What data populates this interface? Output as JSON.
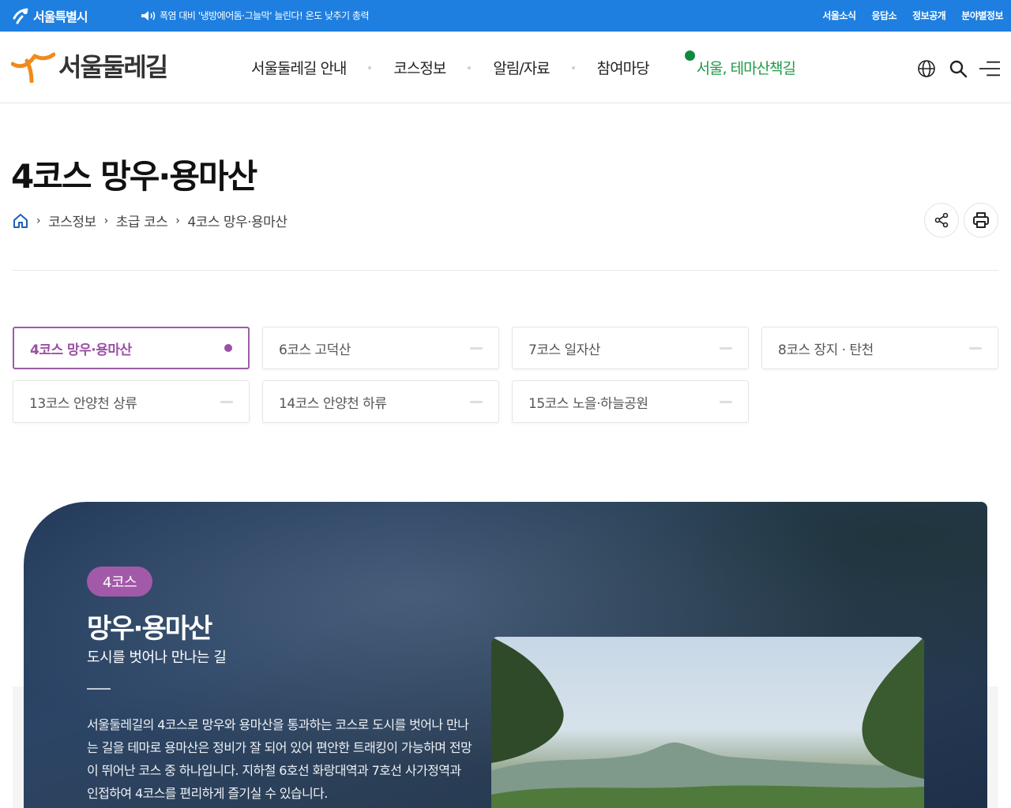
{
  "topbar": {
    "city_name": "서울특별시",
    "notice": "폭염 대비 '냉방에어돔·그늘막' 늘린다! 온도 낮추기 총력",
    "util_links": [
      "서울소식",
      "응답소",
      "정보공개",
      "분야별정보"
    ]
  },
  "header": {
    "logo_text": "서울둘레길",
    "nav": [
      "서울둘레길 안내",
      "코스정보",
      "알림/자료",
      "참여마당"
    ],
    "theme_link": "서울, 테마산책길"
  },
  "page": {
    "title": "4코스 망우·용마산",
    "breadcrumb": [
      "코스정보",
      "초급 코스",
      "4코스 망우·용마산"
    ]
  },
  "course_tabs": [
    {
      "label": "4코스 망우·용마산",
      "active": true
    },
    {
      "label": "6코스 고덕산",
      "active": false
    },
    {
      "label": "7코스 일자산",
      "active": false
    },
    {
      "label": "8코스 장지 · 탄천",
      "active": false
    },
    {
      "label": "13코스 안양천 상류",
      "active": false
    },
    {
      "label": "14코스 안양천 하류",
      "active": false
    },
    {
      "label": "15코스 노을·하늘공원",
      "active": false
    }
  ],
  "hero": {
    "badge": "4코스",
    "course_name": "망우·용마산",
    "subtitle": "도시를 벗어나 만나는 길",
    "description": "서울둘레길의 4코스로 망우와 용마산을 통과하는 코스로 도시를 벗어나 만나는 길을 테마로 용마산은 정비가 잘 되어 있어 편안한 트래킹이 가능하며 전망이 뛰어난 코스 중 하나입니다. 지하철 6호선 화랑대역과 7호선 사가정역과 인접하여 4코스를 편리하게 즐기실 수 있습니다."
  },
  "colors": {
    "topbar": "#1e7fe0",
    "accent_purple": "#9b4fa5",
    "theme_green": "#1f9a48"
  },
  "icons": [
    "seoul-logo-icon",
    "speaker-icon",
    "dulle-logo-icon",
    "globe-icon",
    "search-icon",
    "menu-icon",
    "home-icon",
    "share-icon",
    "print-icon"
  ]
}
